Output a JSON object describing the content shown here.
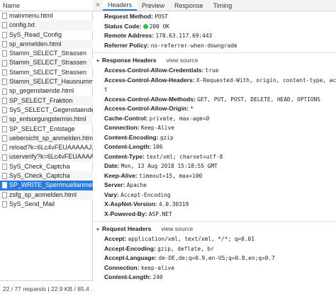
{
  "left": {
    "header": "Name",
    "rows": [
      "mainmenu.html",
      "config.txt",
      "SyS_Read_Config",
      "sp_anmelden.html",
      "Stamm_SELECT_Strassen",
      "Stamm_SELECT_Strassen",
      "Stamm_SELECT_Strassen",
      "Stamm_SELECT_Hausnummer",
      "sp_gegenstaende.html",
      "SP_SELECT_Fraktion",
      "SyS_SELECT_Gegenstaende",
      "sp_entsorgungstermin.html",
      "SP_SELECT_Entstage",
      "uebersicht_sp_anmelden.html",
      "reload?k=6Lc4vFEUAAAAAJ...",
      "userverify?k=6Lc4vFEUAAAA...",
      "SyS_Check_Captcha",
      "SyS_Check_Captcha",
      "SP_WRITE_Sperrmuellanmel...",
      "zsfg_sp_anmelden.html",
      "SyS_Send_Mail"
    ],
    "selected_index": 18,
    "footer": "22 / 77 requests | 22.9 KB / 85.4 ..."
  },
  "tabs": {
    "close": "×",
    "items": [
      "Headers",
      "Preview",
      "Response",
      "Timing"
    ],
    "active": 0
  },
  "general": [
    {
      "k": "Request Method:",
      "v": "POST"
    },
    {
      "k": "Status Code:",
      "v": "200 OK"
    },
    {
      "k": "Remote Address:",
      "v": "178.63.117.69:443"
    },
    {
      "k": "Referrer Policy:",
      "v": "no-referrer-when-downgrade"
    }
  ],
  "response_headers": {
    "title": "Response Headers",
    "view_source": "view source",
    "items": [
      {
        "k": "Access-Control-Allow-Credentials:",
        "v": "true"
      },
      {
        "k": "Access-Control-Allow-Headers:",
        "v": "X-Requested-With, origin, content-type, accep",
        "v2": "t"
      },
      {
        "k": "Access-Control-Allow-Methods:",
        "v": "GET, PUT, POST, DELETE, HEAD, OPTIONS"
      },
      {
        "k": "Access-Control-Allow-Origin:",
        "v": "*"
      },
      {
        "k": "Cache-Control:",
        "v": "private, max-age=0"
      },
      {
        "k": "Connection:",
        "v": "Keep-Alive"
      },
      {
        "k": "Content-Encoding:",
        "v": "gzip"
      },
      {
        "k": "Content-Length:",
        "v": "106"
      },
      {
        "k": "Content-Type:",
        "v": "text/xml; charset=utf-8"
      },
      {
        "k": "Date:",
        "v": "Mon, 13 Aug 2018 15:18:55 GMT"
      },
      {
        "k": "Keep-Alive:",
        "v": "timeout=15, max=100"
      },
      {
        "k": "Server:",
        "v": "Apache"
      },
      {
        "k": "Vary:",
        "v": "Accept-Encoding"
      },
      {
        "k": "X-AspNet-Version:",
        "v": "4.0.30319"
      },
      {
        "k": "X-Powered-By:",
        "v": "ASP.NET"
      }
    ]
  },
  "request_headers": {
    "title": "Request Headers",
    "view_source": "view source",
    "items": [
      {
        "k": "Accept:",
        "v": "application/xml, text/xml, */*; q=0.01"
      },
      {
        "k": "Accept-Encoding:",
        "v": "gzip, deflate, br"
      },
      {
        "k": "Accept-Language:",
        "v": "de-DE,de;q=0.9,en-US;q=0.8,en;q=0.7"
      },
      {
        "k": "Connection:",
        "v": "keep-alive"
      },
      {
        "k": "Content-Length:",
        "v": "240"
      }
    ]
  },
  "colors": {
    "accent": "#2a7ad9",
    "status_dot": "#2fbf4a"
  }
}
